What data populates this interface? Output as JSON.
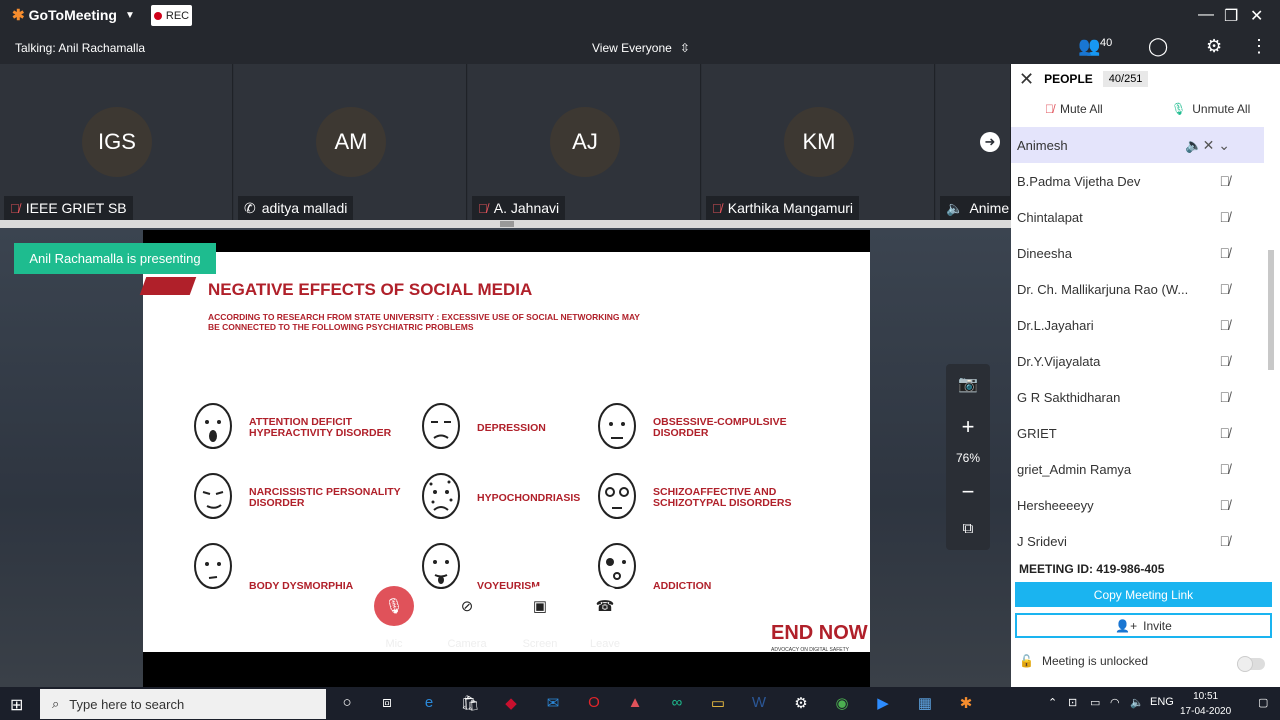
{
  "app": {
    "brand": "GoToMeeting",
    "rec_label": "REC",
    "accent": "#1ebc8f"
  },
  "subbar": {
    "talking": "Talking: Anil Rachamalla",
    "view": "View Everyone",
    "people_count": "40"
  },
  "tiles": [
    {
      "initials": "IGS",
      "name": "IEEE GRIET SB"
    },
    {
      "initials": "AM",
      "name": "aditya malladi"
    },
    {
      "initials": "AJ",
      "name": "A. Jahnavi"
    },
    {
      "initials": "KM",
      "name": "Karthika Mangamuri"
    },
    {
      "initials": "",
      "name": "Anime"
    }
  ],
  "stage": {
    "presenting": "Anil Rachamalla is presenting",
    "zoom": "76%"
  },
  "slide": {
    "title": "NEGATIVE EFFECTS OF SOCIAL MEDIA",
    "subtitle": "ACCORDING TO RESEARCH FROM STATE UNIVERSITY : EXCESSIVE USE OF SOCIAL NETWORKING MAY BE CONNECTED TO THE FOLLOWING PSYCHIATRIC PROBLEMS",
    "items": [
      "ATTENTION DEFICIT HYPERACTIVITY DISORDER",
      "DEPRESSION",
      "OBSESSIVE-COMPULSIVE DISORDER",
      "NARCISSISTIC PERSONALITY DISORDER",
      "HYPOCHONDRIASIS",
      "SCHIZOAFFECTIVE AND SCHIZOTYPAL DISORDERS",
      "BODY DYSMORPHIA",
      "VOYEURISM",
      "ADDICTION"
    ],
    "logo": "END NOW",
    "logo_sub": "ADVOCACY ON DIGITAL SAFETY"
  },
  "controls": {
    "mic": "Mic",
    "camera": "Camera",
    "screen": "Screen",
    "leave": "Leave"
  },
  "panel": {
    "title": "PEOPLE",
    "count": "40/251",
    "mute_all": "Mute All",
    "unmute_all": "Unmute All",
    "people": [
      "Animesh",
      "B.Padma Vijetha Dev",
      "Chintalapat",
      "Dineesha",
      "Dr. Ch. Mallikarjuna Rao  (W...",
      "Dr.L.Jayahari",
      "Dr.Y.Vijayalata",
      "G R Sakthidharan",
      "GRIET",
      "griet_Admin Ramya",
      "Hersheeeeyy",
      "J Sridevi"
    ],
    "meeting_id": "MEETING ID:  419-986-405",
    "copy_link": "Copy Meeting Link",
    "invite": "Invite",
    "lock_status": "Meeting is unlocked"
  },
  "taskbar": {
    "search_placeholder": "Type here to search",
    "lang": "ENG",
    "time": "10:51",
    "date": "17-04-2020"
  }
}
